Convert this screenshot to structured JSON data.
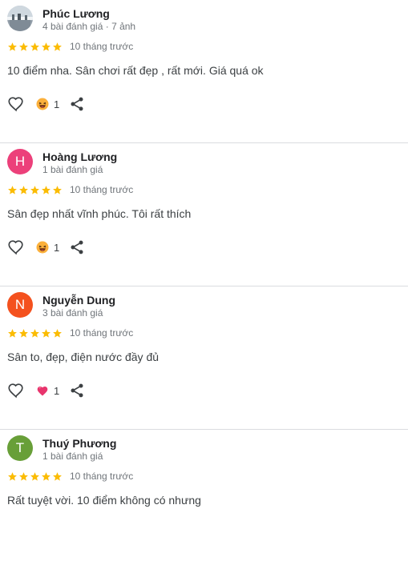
{
  "reviews": [
    {
      "author": "Phúc Lương",
      "meta": "4 bài đánh giá · 7 ảnh",
      "avatar_initial": "",
      "avatar_color": "#b0bcc6",
      "rating": 5,
      "time": "10 tháng trước",
      "text": "10 điểm nha. Sân chơi rất đẹp , rất mới. Giá quá ok",
      "reaction_icon": "laughing-emoji-icon",
      "reaction_count": "1"
    },
    {
      "author": "Hoàng Lương",
      "meta": "1 bài đánh giá",
      "avatar_initial": "H",
      "avatar_color": "#ec407a",
      "rating": 5,
      "time": "10 tháng trước",
      "text": "Sân đẹp nhất vĩnh phúc. Tôi rất thích",
      "reaction_icon": "laughing-emoji-icon",
      "reaction_count": "1"
    },
    {
      "author": "Nguyễn Dung",
      "meta": "3 bài đánh giá",
      "avatar_initial": "N",
      "avatar_color": "#f4511e",
      "rating": 5,
      "time": "10 tháng trước",
      "text": "Sân to, đẹp, điện nước đầy đủ",
      "reaction_icon": "heart-reaction-icon",
      "reaction_count": "1"
    },
    {
      "author": "Thuý Phương",
      "meta": "1 bài đánh giá",
      "avatar_initial": "T",
      "avatar_color": "#689f38",
      "rating": 5,
      "time": "10 tháng trước",
      "text": "Rất tuyệt vời. 10 điểm không có nhưng"
    }
  ],
  "colors": {
    "star": "#fbbc04",
    "secondary_text": "#70757a",
    "divider": "#dadce0"
  },
  "icons": {
    "like": "heart-outline-icon",
    "share": "share-icon",
    "star": "star-icon"
  }
}
